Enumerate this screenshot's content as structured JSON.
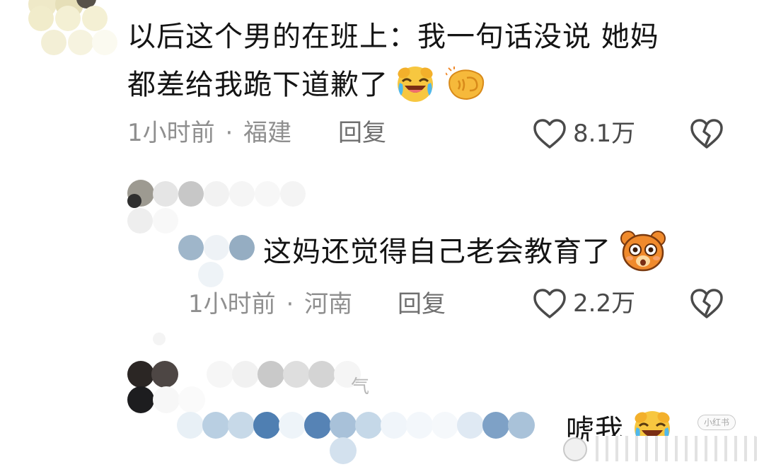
{
  "comments": [
    {
      "text_line1": "以后这个男的在班上：我一句话没说 她妈",
      "text_line2": "都差给我跪下道歉了",
      "time": "1小时前",
      "separator": "·",
      "location": "福建",
      "reply_label": "回复",
      "likes": "8.1万",
      "emojis": [
        "laughing-crying-emoji",
        "fist-emoji"
      ]
    },
    {
      "text": "这妈还觉得自己老会教育了",
      "time": "1小时前",
      "separator": "·",
      "location": "河南",
      "reply_label": "回复",
      "likes": "2.2万",
      "emojis": [
        "surprised-bear-emoji"
      ]
    },
    {
      "text": "唬我",
      "emojis": [
        "laughing-crying-emoji"
      ],
      "partial_char": "气"
    }
  ],
  "watermark": {
    "logo": "小红书"
  },
  "icons": {
    "like": "heart-outline-icon",
    "dislike": "broken-heart-icon"
  },
  "colors": {
    "text": "#141414",
    "meta": "#8f8f8f",
    "icon": "#4a4a4a",
    "emoji_yellow": "#f7c740",
    "emoji_orange": "#f08a2c"
  }
}
